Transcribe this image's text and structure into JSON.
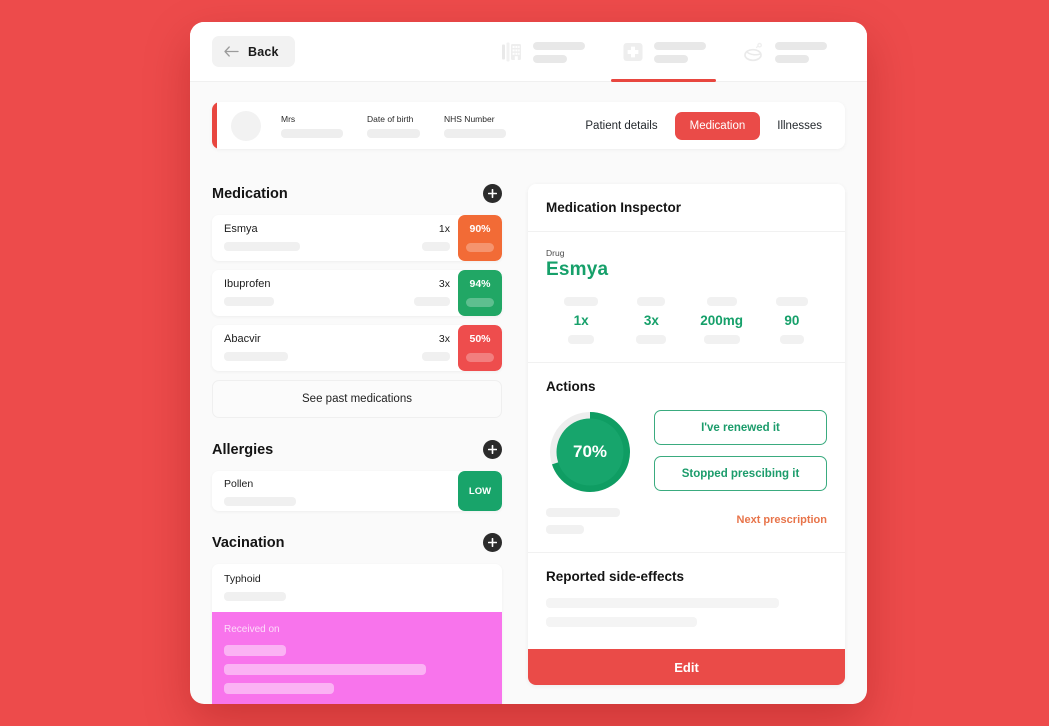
{
  "theme": {
    "page_bg": "#ed4b4b",
    "accent_red": "#ea4b48",
    "accent_green": "#16a06a",
    "accent_orange": "#f26b36",
    "accent_pink": "#f874ec"
  },
  "topbar": {
    "back_label": "Back",
    "back_icon": "arrow-left-icon",
    "nav_items": [
      {
        "icon": "hospital-building-icon",
        "active": false
      },
      {
        "icon": "medical-cross-icon",
        "active": true
      },
      {
        "icon": "pills-icon",
        "active": false
      }
    ]
  },
  "patient": {
    "avatar_icon": "avatar-placeholder",
    "fields": [
      {
        "label": "Mrs",
        "skeleton_width": 62
      },
      {
        "label": "Date of birth",
        "skeleton_width": 53
      },
      {
        "label": "NHS Number",
        "skeleton_width": 62
      }
    ],
    "tabs": [
      {
        "label": "Patient details",
        "active": false
      },
      {
        "label": "Medication",
        "active": true
      },
      {
        "label": "Illnesses",
        "active": false
      }
    ]
  },
  "medication_section": {
    "title": "Medication",
    "add_icon": "plus-icon",
    "items": [
      {
        "name": "Esmya",
        "quantity": "1x",
        "percent": "90%",
        "color": "#f26b36"
      },
      {
        "name": "Ibuprofen",
        "quantity": "3x",
        "percent": "94%",
        "color": "#21a765"
      },
      {
        "name": "Abacvir",
        "quantity": "3x",
        "percent": "50%",
        "color": "#ee4d4d"
      }
    ],
    "past_button": "See past medications"
  },
  "allergies_section": {
    "title": "Allergies",
    "add_icon": "plus-icon",
    "items": [
      {
        "name": "Pollen",
        "level": "LOW",
        "color": "#18a46a"
      }
    ]
  },
  "vaccination_section": {
    "title": "Vacination",
    "add_icon": "plus-icon",
    "item": {
      "name": "Typhoid",
      "body_label": "Received on",
      "body_color": "#f874ec"
    }
  },
  "inspector": {
    "title": "Medication Inspector",
    "drug_label": "Drug",
    "drug_name": "Esmya",
    "stats": [
      {
        "value": "1x"
      },
      {
        "value": "3x"
      },
      {
        "value": "200mg"
      },
      {
        "value": "90"
      }
    ]
  },
  "actions": {
    "title": "Actions",
    "progress_percent": "70%",
    "progress_value": 70,
    "buttons": [
      {
        "label": "I've renewed it"
      },
      {
        "label": "Stopped prescibing it"
      }
    ],
    "link_label": "Next prescription"
  },
  "side_effects": {
    "title": "Reported side-effects"
  },
  "footer": {
    "edit_label": "Edit"
  }
}
